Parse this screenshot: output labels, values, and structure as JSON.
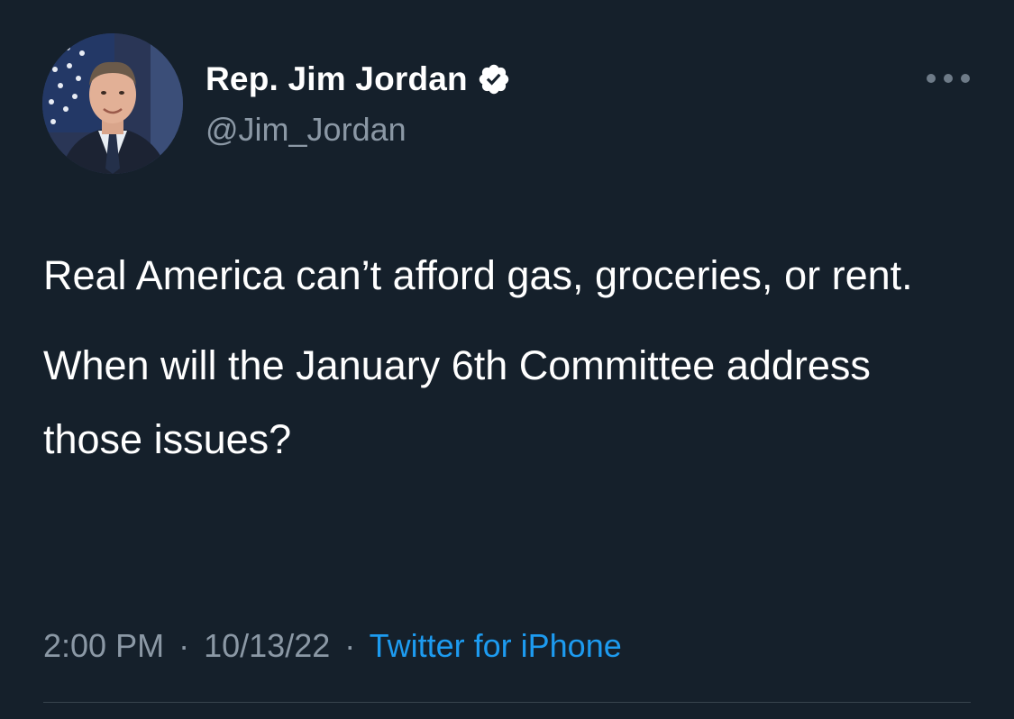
{
  "author": {
    "display_name": "Rep. Jim Jordan",
    "handle": "@Jim_Jordan",
    "verified": true
  },
  "tweet": {
    "paragraphs": [
      "Real America can’t afford gas, groceries, or rent.",
      "When will the January 6th Committee address those issues?"
    ]
  },
  "meta": {
    "time": "2:00 PM",
    "separator": "·",
    "date": "10/13/22",
    "source": "Twitter for iPhone"
  },
  "icons": {
    "verified": "verified-badge-icon",
    "more": "more-options-icon"
  },
  "colors": {
    "background": "#15202b",
    "text_primary": "#ffffff",
    "text_secondary": "#8b98a5",
    "accent": "#1d9bf0"
  }
}
